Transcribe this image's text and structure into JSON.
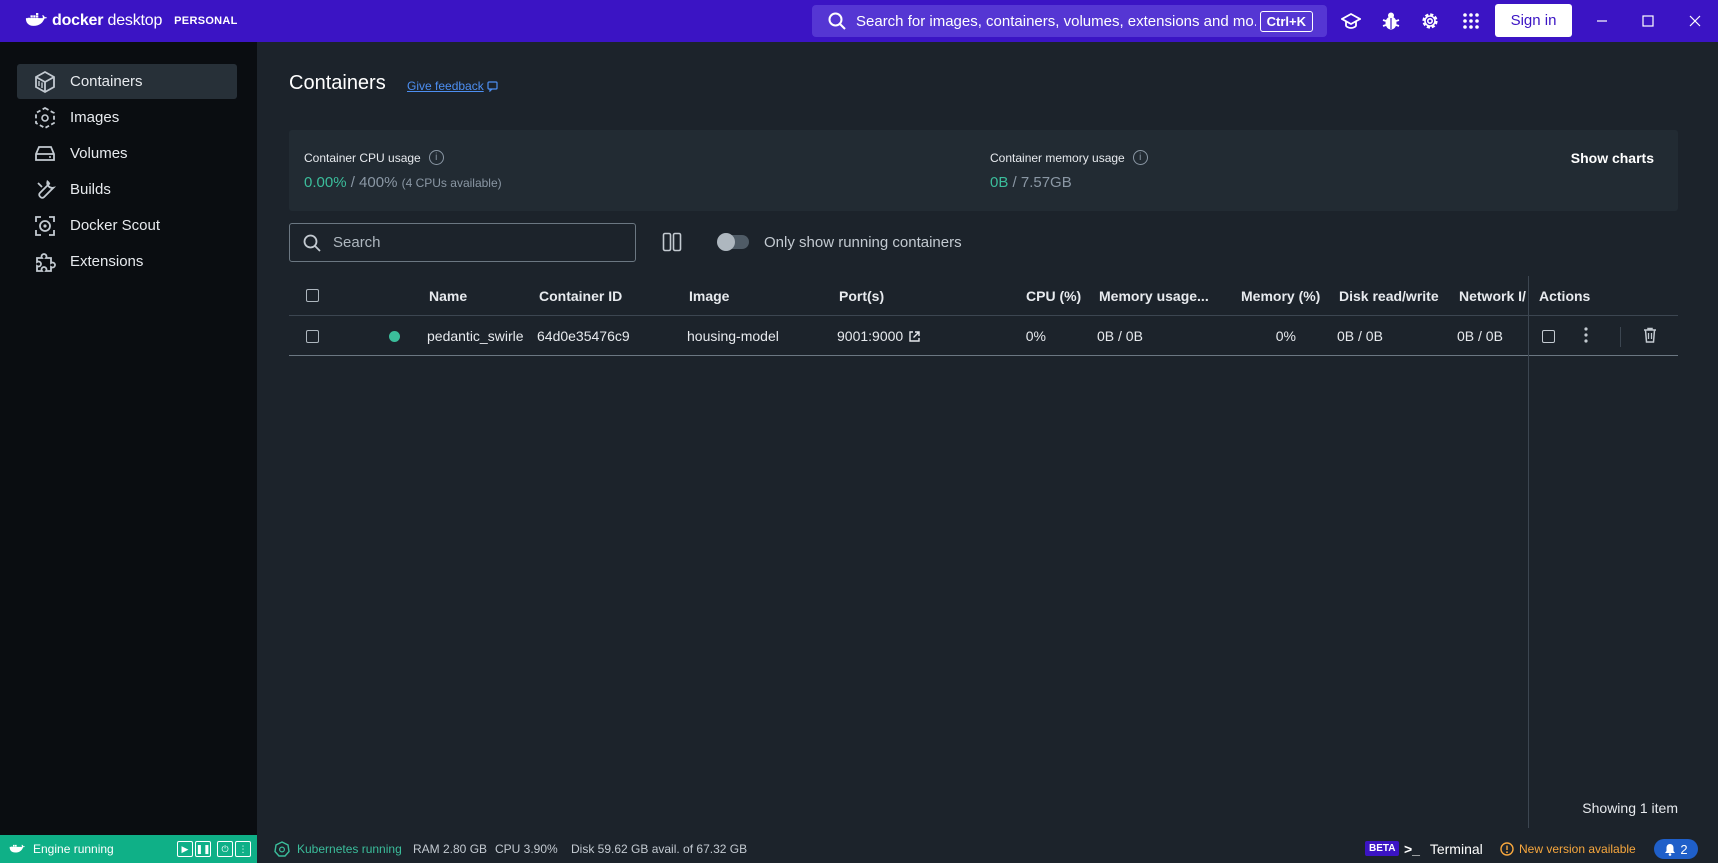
{
  "titlebar": {
    "app_name_prefix": "docker",
    "app_name_suffix": "desktop",
    "plan": "PERSONAL",
    "search_placeholder": "Search for images, containers, volumes, extensions and mo...",
    "search_shortcut": "Ctrl+K",
    "sign_in": "Sign in"
  },
  "sidebar": {
    "items": [
      {
        "label": "Containers",
        "icon": "container-icon",
        "active": true
      },
      {
        "label": "Images",
        "icon": "image-icon",
        "active": false
      },
      {
        "label": "Volumes",
        "icon": "volume-icon",
        "active": false
      },
      {
        "label": "Builds",
        "icon": "wrench-icon",
        "active": false
      },
      {
        "label": "Docker Scout",
        "icon": "scout-icon",
        "active": false
      },
      {
        "label": "Extensions",
        "icon": "puzzle-icon",
        "active": false
      }
    ]
  },
  "main": {
    "title": "Containers",
    "feedback": "Give feedback",
    "cpu": {
      "label": "Container CPU usage",
      "used": "0.00%",
      "total": "/ 400%",
      "note": "(4 CPUs available)"
    },
    "memory": {
      "label": "Container memory usage",
      "used": "0B",
      "total": "/ 7.57GB"
    },
    "show_charts": "Show charts",
    "search_placeholder": "Search",
    "toggle_label": "Only show running containers",
    "columns": {
      "name": "Name",
      "id": "Container ID",
      "image": "Image",
      "ports": "Port(s)",
      "cpu": "CPU (%)",
      "mem_usage": "Memory usage...",
      "mem_pct": "Memory (%)",
      "disk": "Disk read/write",
      "network": "Network I/",
      "actions": "Actions"
    },
    "rows": [
      {
        "name": "pedantic_swirle",
        "id": "64d0e35476c9",
        "image": "housing-model",
        "ports": "9001:9000",
        "cpu": "0%",
        "mem_usage": "0B / 0B",
        "mem_pct": "0%",
        "disk": "0B / 0B",
        "network": "0B / 0B",
        "status_color": "#3bbd9b"
      }
    ],
    "showing": "Showing 1 item"
  },
  "footer": {
    "engine": "Engine running",
    "kubernetes": "Kubernetes running",
    "ram": "RAM 2.80 GB",
    "cpu": "CPU 3.90%",
    "disk": "Disk 59.62 GB avail. of 67.32 GB",
    "beta": "BETA",
    "terminal": "Terminal",
    "new_version": "New version available",
    "notifications": "2"
  }
}
